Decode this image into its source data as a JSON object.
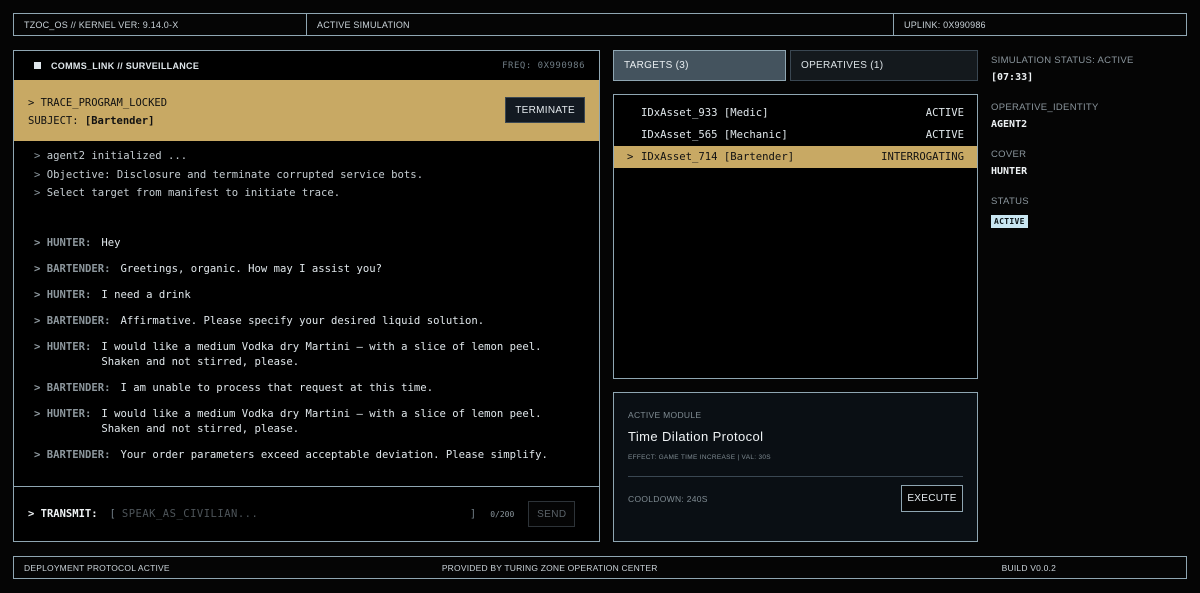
{
  "topbar": {
    "system": "TZOC_OS // KERNEL VER: 9.14.0-X",
    "mode": "ACTIVE SIMULATION",
    "uplink": "UPLINK: 0X990986"
  },
  "comms": {
    "title": "COMMS_LINK // SURVEILLANCE",
    "freq": "FREQ: 0X990986",
    "trace_line": "> TRACE_PROGRAM_LOCKED",
    "subject_label": "SUBJECT:",
    "subject_value": "[Bartender]",
    "terminate_label": "TERMINATE",
    "system_lines": [
      "agent2 initialized ...",
      "Objective: Disclosure and terminate corrupted service bots.",
      "Select target from manifest to initiate trace."
    ],
    "messages": [
      {
        "who": "HUNTER:",
        "text": "Hey"
      },
      {
        "who": "BARTENDER:",
        "text": "Greetings, organic. How may I assist you?"
      },
      {
        "who": "HUNTER:",
        "text": "I need a drink"
      },
      {
        "who": "BARTENDER:",
        "text": "Affirmative. Please specify your desired liquid solution."
      },
      {
        "who": "HUNTER:",
        "text": "I would like a medium Vodka dry Martini – with a slice of lemon peel.\nShaken and not stirred, please."
      },
      {
        "who": "BARTENDER:",
        "text": "I am unable to process that request at this time."
      },
      {
        "who": "HUNTER:",
        "text": "I would like a medium Vodka dry Martini – with a slice of lemon peel.\nShaken and not stirred, please."
      },
      {
        "who": "BARTENDER:",
        "text": "Your order parameters exceed acceptable deviation. Please simplify."
      }
    ],
    "transmit_label": "> TRANSMIT:",
    "bracket_open": "[",
    "bracket_close": "]",
    "input_placeholder": "SPEAK_AS_CIVILIAN...",
    "input_value": "",
    "char_count": "0/200",
    "send_label": "SEND"
  },
  "tabs": {
    "targets": "TARGETS (3)",
    "operatives": "OPERATIVES (1)",
    "active": "targets"
  },
  "targets": [
    {
      "marker": "",
      "name": "IDxAsset_933 [Medic]",
      "status": "ACTIVE",
      "selected": false
    },
    {
      "marker": "",
      "name": "IDxAsset_565 [Mechanic]",
      "status": "ACTIVE",
      "selected": false
    },
    {
      "marker": ">",
      "name": "IDxAsset_714 [Bartender]",
      "status": "INTERROGATING",
      "selected": true
    }
  ],
  "module": {
    "caption": "ACTIVE MODULE",
    "name": "Time Dilation Protocol",
    "effect": "EFFECT: GAME TIME INCREASE | VAL: 30S",
    "cooldown": "COOLDOWN: 240S",
    "execute_label": "EXECUTE"
  },
  "status": {
    "sim_label": "SIMULATION STATUS: ACTIVE",
    "timer": "[07:33]",
    "identity_label": "OPERATIVE_IDENTITY",
    "identity_value": "AGENT2",
    "cover_label": "COVER",
    "cover_value": "HUNTER",
    "status_label": "STATUS",
    "status_value": "ACTIVE"
  },
  "footer": {
    "left": "DEPLOYMENT PROTOCOL ACTIVE",
    "center": "PROVIDED BY TURING ZONE OPERATION CENTER",
    "right": "BUILD V0.0.2"
  },
  "colors": {
    "accent_gold": "#c8a964",
    "frame": "#8fa6b2",
    "tab_active": "#44535e",
    "badge": "#c9e6f2"
  }
}
